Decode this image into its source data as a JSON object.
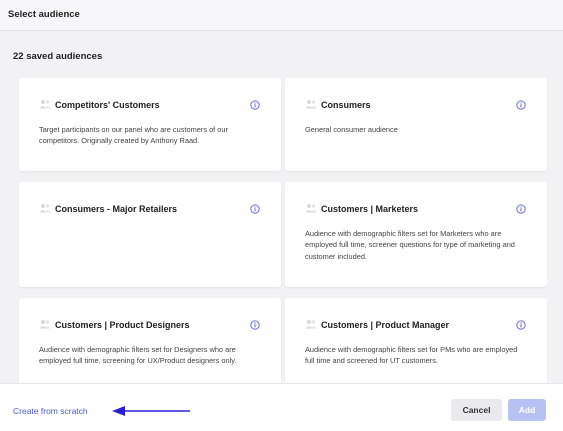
{
  "header": {
    "title": "Select audience"
  },
  "main": {
    "count_label": "22 saved audiences",
    "audiences": [
      {
        "title": "Competitors' Customers",
        "description": "Target participants on our panel who are customers of our competitors. Originally created by Anthony Raad."
      },
      {
        "title": "Consumers",
        "description": "General consumer audience"
      },
      {
        "title": "Consumers - Major Retailers",
        "description": ""
      },
      {
        "title": "Customers | Marketers",
        "description": "Audience with demographic filters set for Marketers who are employed full time, screener questions for type of marketing and customer included."
      },
      {
        "title": "Customers | Product Designers",
        "description": "Audience with demographic filters set for Designers who are employed full time, screening for UX/Product designers only."
      },
      {
        "title": "Customers | Product Manager",
        "description": "Audience with demographic filters set for PMs who are employed full time and screened for UT customers."
      }
    ]
  },
  "footer": {
    "create_link": "Create from scratch",
    "cancel_label": "Cancel",
    "add_label": "Add"
  },
  "colors": {
    "accent": "#4a57d6",
    "arrow": "#2a1fd9",
    "add_disabled": "#b9c3f3",
    "info_icon": "#5a63d8"
  },
  "icons": {
    "audience": "users-icon",
    "info": "info-icon"
  }
}
